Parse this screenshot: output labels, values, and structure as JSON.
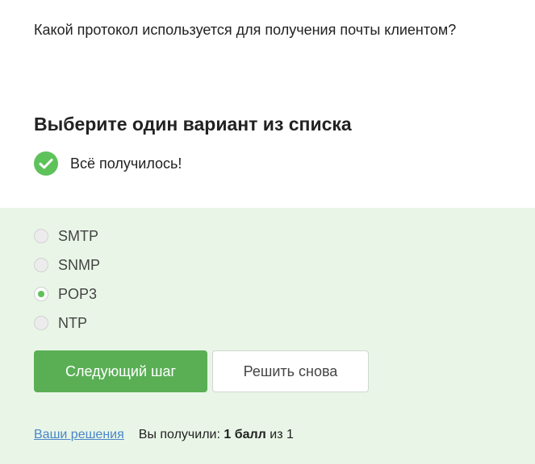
{
  "question": {
    "text": "Какой протокол используется для получения почты клиентом?"
  },
  "instruction": {
    "title": "Выберите один вариант из списка"
  },
  "status": {
    "icon": "check-circle-icon",
    "text": "Всё получилось!",
    "color": "#5ec25b"
  },
  "options": [
    {
      "label": "SMTP",
      "selected": false
    },
    {
      "label": "SNMP",
      "selected": false
    },
    {
      "label": "POP3",
      "selected": true
    },
    {
      "label": "NTP",
      "selected": false
    }
  ],
  "buttons": {
    "next_label": "Следующий шаг",
    "retry_label": "Решить снова"
  },
  "footer": {
    "solutions_link": "Ваши решения",
    "score_prefix": "Вы получили:",
    "score_value": "1 балл",
    "score_suffix": "из 1"
  },
  "colors": {
    "accent": "#5aaf55",
    "panel_background": "#e9f6e7",
    "link": "#4a86c8"
  }
}
